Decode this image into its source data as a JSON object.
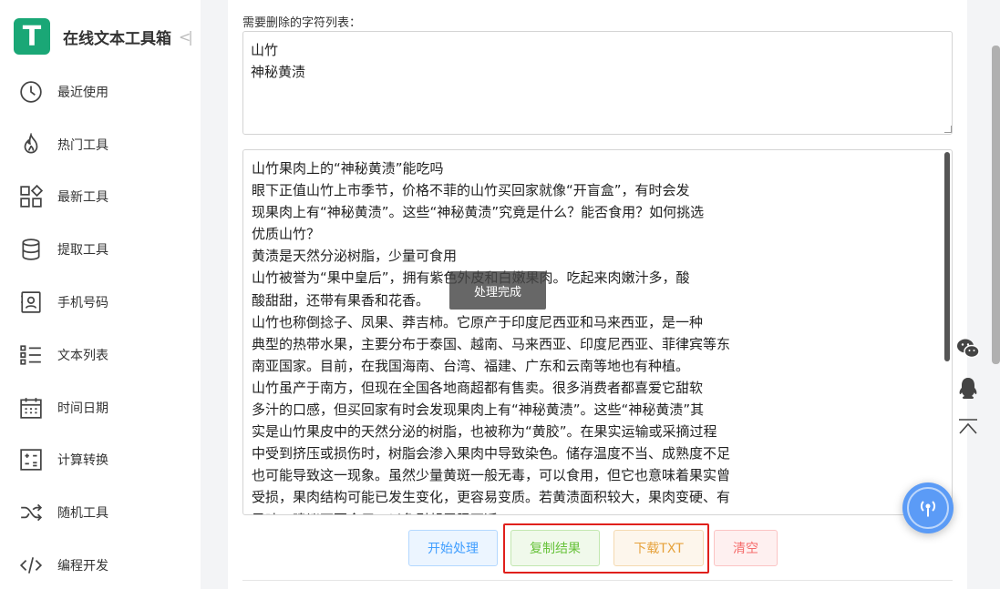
{
  "brand": {
    "logo_letter": "T",
    "title": "在线文本工具箱",
    "collapse_icon": "collapse-icon"
  },
  "nav": {
    "items": [
      {
        "label": "最近使用",
        "icon": "clock-icon"
      },
      {
        "label": "热门工具",
        "icon": "flame-icon"
      },
      {
        "label": "最新工具",
        "icon": "grid-icon"
      },
      {
        "label": "提取工具",
        "icon": "database-icon"
      },
      {
        "label": "手机号码",
        "icon": "contact-card-icon"
      },
      {
        "label": "文本列表",
        "icon": "list-icon"
      },
      {
        "label": "时间日期",
        "icon": "calendar-icon"
      },
      {
        "label": "计算转换",
        "icon": "calculator-icon"
      },
      {
        "label": "随机工具",
        "icon": "shuffle-icon"
      },
      {
        "label": "编程开发",
        "icon": "code-icon"
      }
    ]
  },
  "main": {
    "chars_label": "需要删除的字符列表：",
    "chars_value": "山竹\n神秘黄渍",
    "text_lines": [
      "山竹果肉上的“神秘黄渍”能吃吗",
      "眼下正值山竹上市季节，价格不菲的山竹买回家就像“开盲盒”，有时会发",
      "现果肉上有“神秘黄渍”。这些“神秘黄渍”究竟是什么？能否食用？如何挑选",
      "优质山竹？",
      "黄渍是天然分泌树脂，少量可食用",
      "山竹被誉为“果中皇后”，拥有紫色外皮和白嫩果肉。吃起来肉嫩汁多，酸",
      "酸甜甜，还带有果香和花香。",
      "山竹也称倒捻子、凤果、莽吉柿。它原产于印度尼西亚和马来西亚，是一种",
      "典型的热带水果，主要分布于泰国、越南、马来西亚、印度尼西亚、菲律宾等东",
      "南亚国家。目前，在我国海南、台湾、福建、广东和云南等地也有种植。",
      "山竹虽产于南方，但现在全国各地商超都有售卖。很多消费者都喜爱它甜软",
      "多汁的口感，但买回家有时会发现果肉上有“神秘黄渍”。这些“神秘黄渍”其",
      "实是山竹果皮中的天然分泌的树脂，也被称为“黄胶”。在果实运输或采摘过程",
      "中受到挤压或损伤时，树脂会渗入果肉中导致染色。储存温度不当、成熟度不足",
      "也可能导致这一现象。虽然少量黄斑一般无毒，可以食用，但它也意味着果实曾",
      "受损，果肉结构可能已发生变化，更容易变质。若黄渍面积较大，果肉变硬、有",
      "异味，建议不要食用，以免引起胃肠不适。"
    ],
    "toast": "处理完成",
    "buttons": {
      "start": "开始处理",
      "copy": "复制结果",
      "download": "下载TXT",
      "clear": "清空"
    }
  },
  "side_tools": [
    "wechat-icon",
    "qq-icon",
    "back-to-top-icon"
  ],
  "float_button_icon": "broadcast-icon",
  "colors": {
    "brand": "#1aa776",
    "highlight": "#e0201c",
    "float": "#5b9bf6"
  }
}
